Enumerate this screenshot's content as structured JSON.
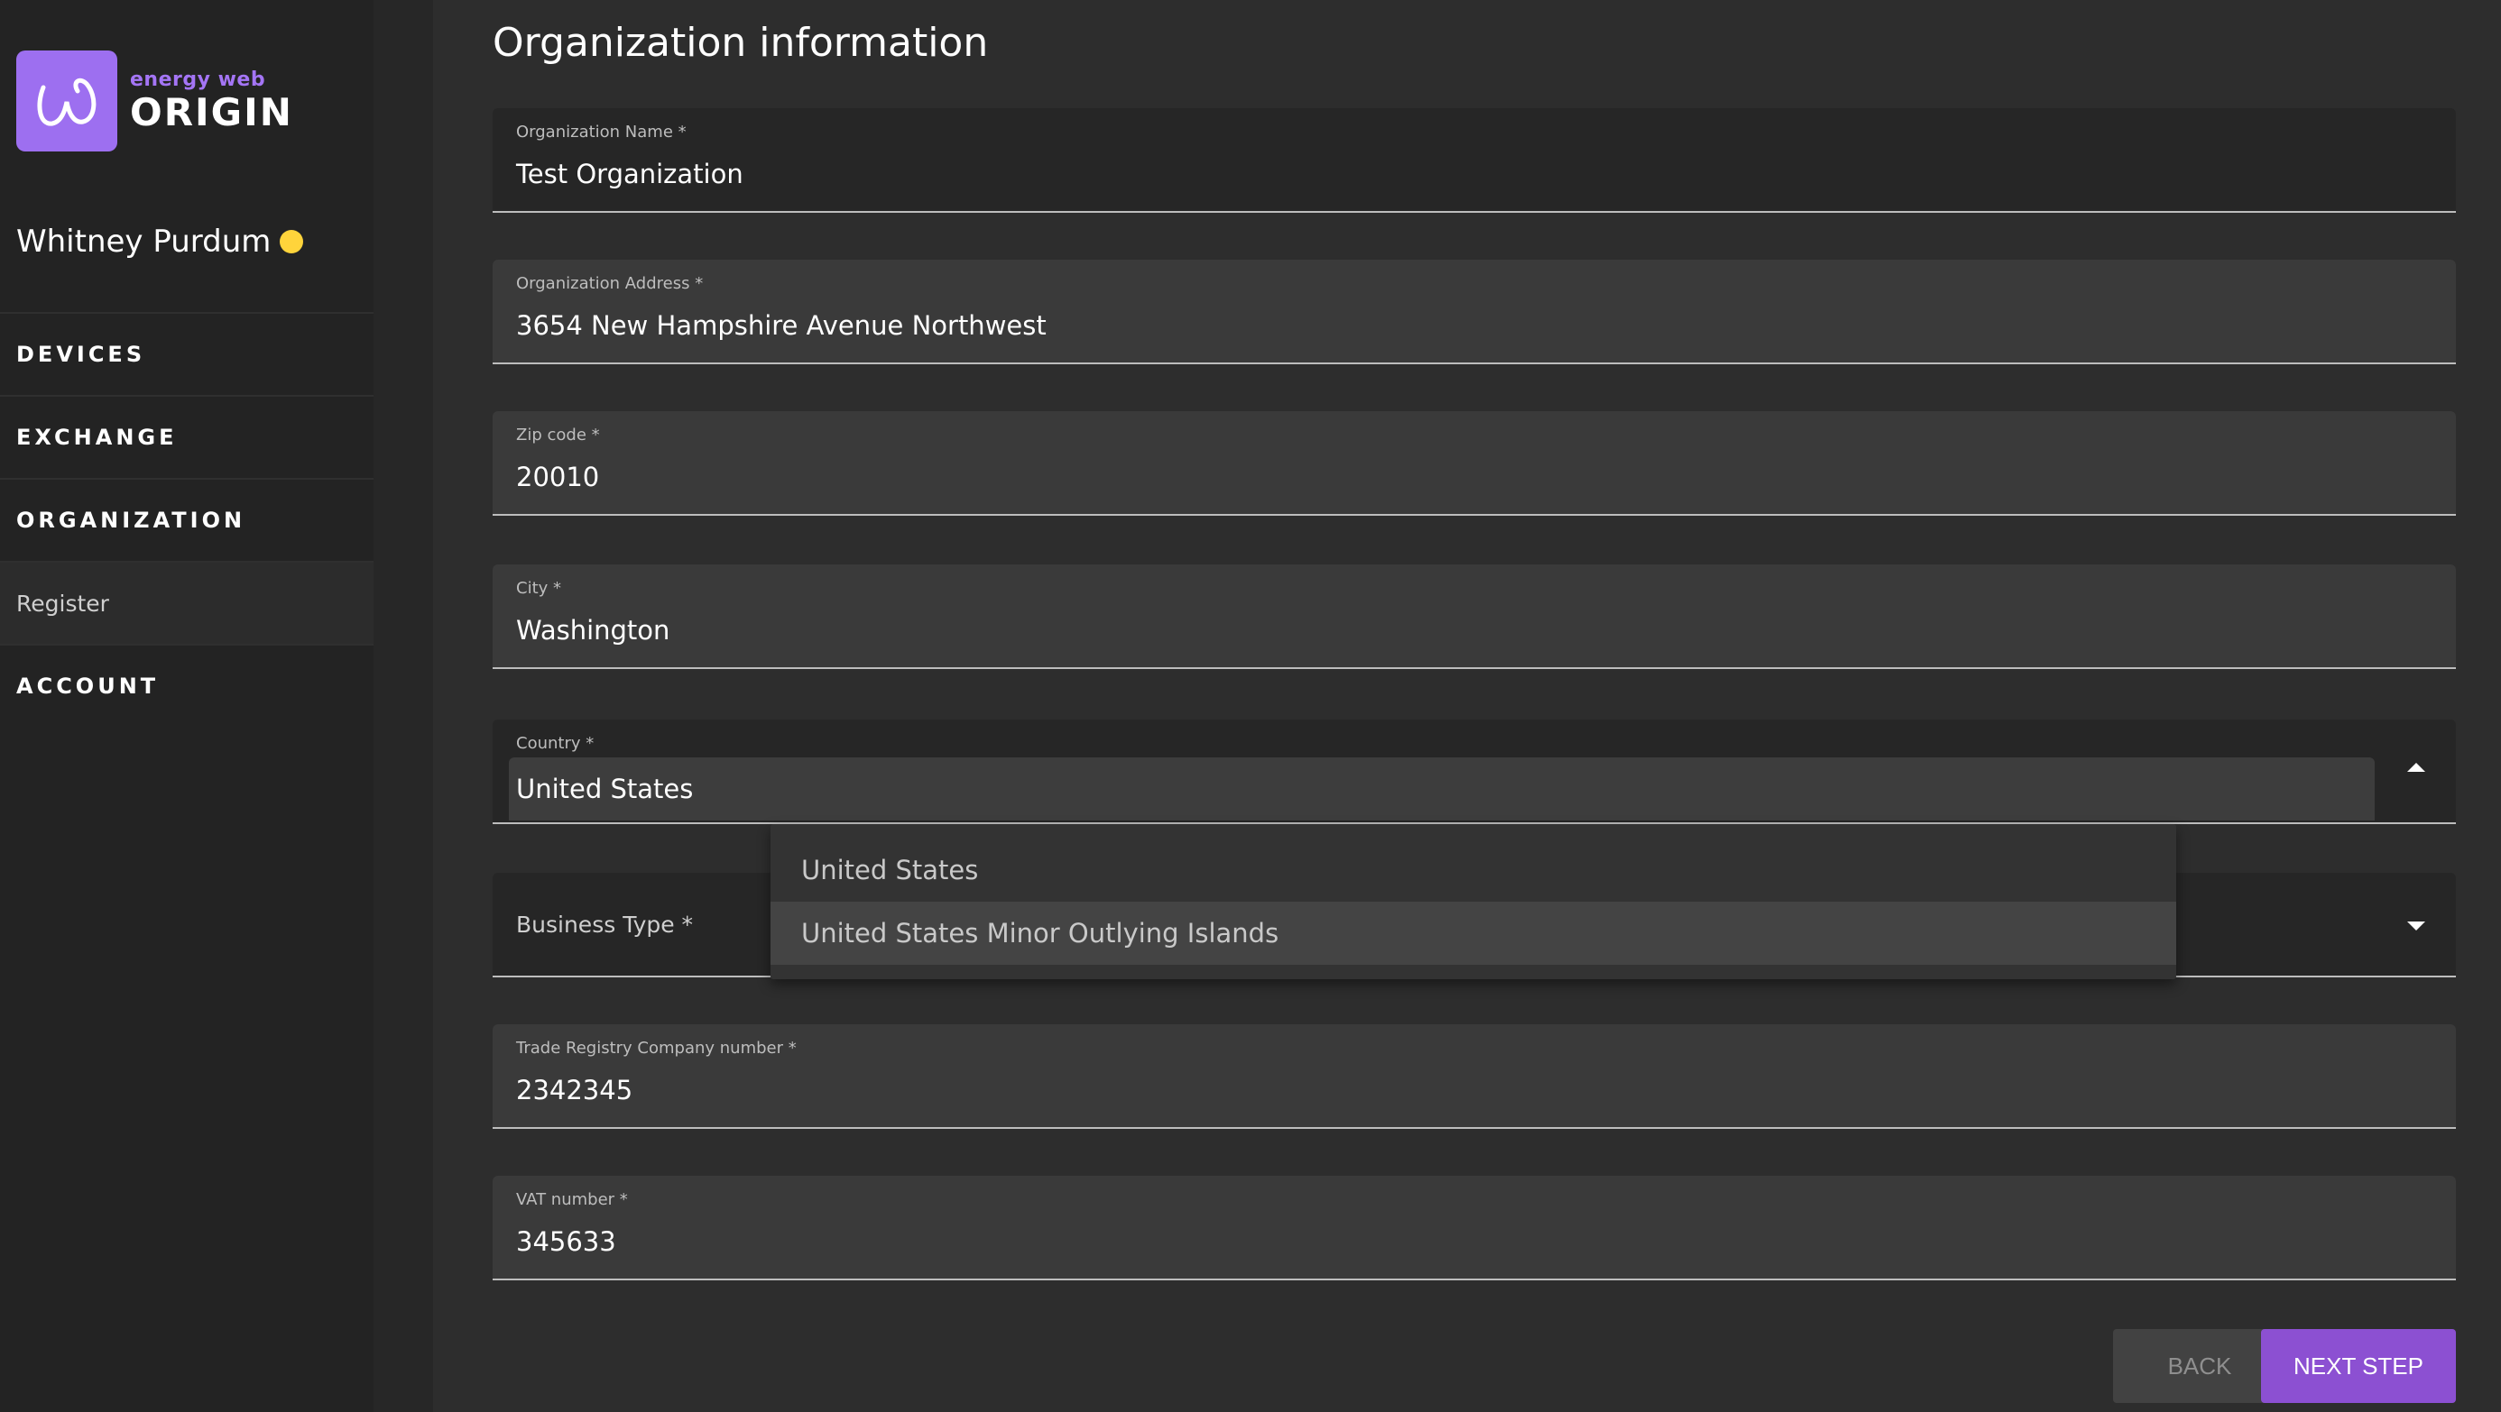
{
  "brand": {
    "small": "energy web",
    "big": "ORIGIN",
    "accent": "#9d6ff0"
  },
  "user": {
    "name": "Whitney Purdum",
    "status_color": "#ffd43b"
  },
  "nav": {
    "devices": "DEVICES",
    "exchange": "EXCHANGE",
    "organization": "ORGANIZATION",
    "register": "Register",
    "account": "ACCOUNT"
  },
  "form": {
    "title": "Organization information",
    "org_name": {
      "label": "Organization Name *",
      "value": "Test Organization"
    },
    "org_address": {
      "label": "Organization Address *",
      "value": "3654 New Hampshire Avenue Northwest"
    },
    "zip": {
      "label": "Zip code *",
      "value": "20010"
    },
    "city": {
      "label": "City *",
      "value": "Washington"
    },
    "country": {
      "label": "Country *",
      "value": "United States"
    },
    "business_type": {
      "label": "Business Type *"
    },
    "trade_registry": {
      "label": "Trade Registry Company number *",
      "value": "2342345"
    },
    "vat": {
      "label": "VAT number *",
      "value": "345633"
    }
  },
  "country_options": [
    "United States",
    "United States Minor Outlying Islands"
  ],
  "buttons": {
    "back": "BACK",
    "next": "NEXT STEP"
  }
}
